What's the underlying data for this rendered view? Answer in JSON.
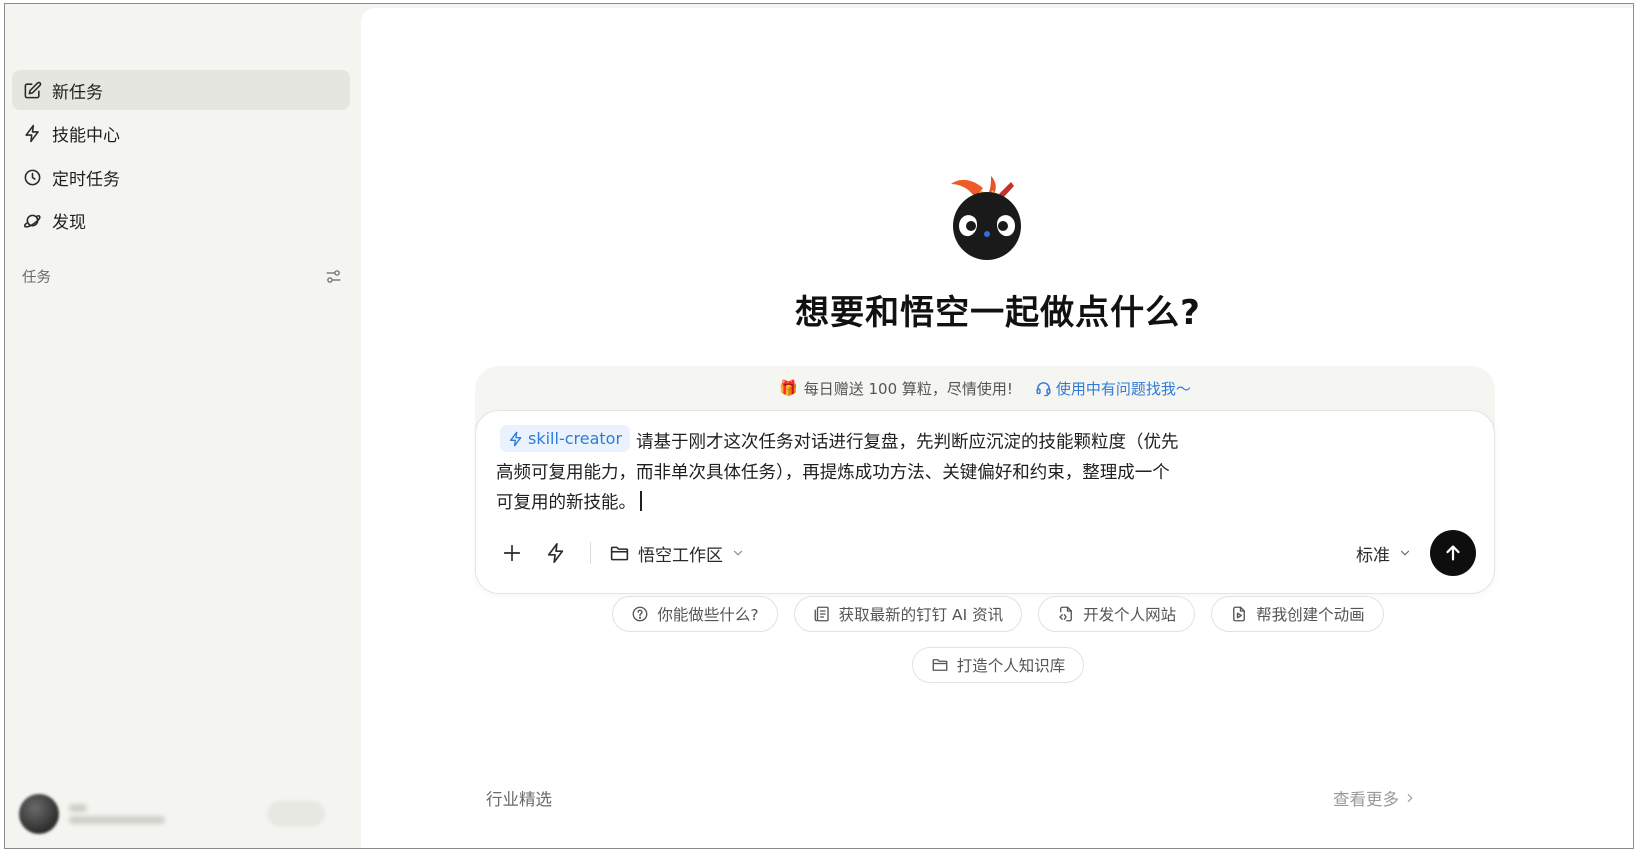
{
  "sidebar": {
    "items": [
      {
        "label": "新任务",
        "icon": "edit-icon",
        "active": true
      },
      {
        "label": "技能中心",
        "icon": "lightning-icon",
        "active": false
      },
      {
        "label": "定时任务",
        "icon": "clock-icon",
        "active": false
      },
      {
        "label": "发现",
        "icon": "planet-icon",
        "active": false
      }
    ],
    "tasks_title": "任务"
  },
  "main": {
    "headline": "想要和悟空一起做点什么?",
    "promo": {
      "gift_icon": "gift-icon",
      "text": "每日赠送 100 算粒，尽情使用!",
      "help": "使用中有问题找我～"
    },
    "composer": {
      "skill_chip": "skill-creator",
      "input_text": "请基于刚才这次任务对话进行复盘，先判断应沉淀的技能颗粒度（优先高频可复用能力，而非单次具体任务），再提炼成功方法、关键偏好和约束，整理成一个可复用的新技能。",
      "workspace": "悟空工作区",
      "mode": "标准"
    },
    "suggestions": [
      {
        "label": "你能做些什么?",
        "icon": "question-circle-icon"
      },
      {
        "label": "获取最新的钉钉 AI 资讯",
        "icon": "news-icon"
      },
      {
        "label": "开发个人网站",
        "icon": "code-file-icon"
      },
      {
        "label": "帮我创建个动画",
        "icon": "video-file-icon"
      },
      {
        "label": "打造个人知识库",
        "icon": "folder-icon"
      }
    ],
    "section_title": "行业精选",
    "see_more": "查看更多"
  },
  "colors": {
    "accent_blue": "#2f7bd8",
    "sidebar_bg": "#f4f4f0",
    "send_button": "#0e0e0e"
  }
}
